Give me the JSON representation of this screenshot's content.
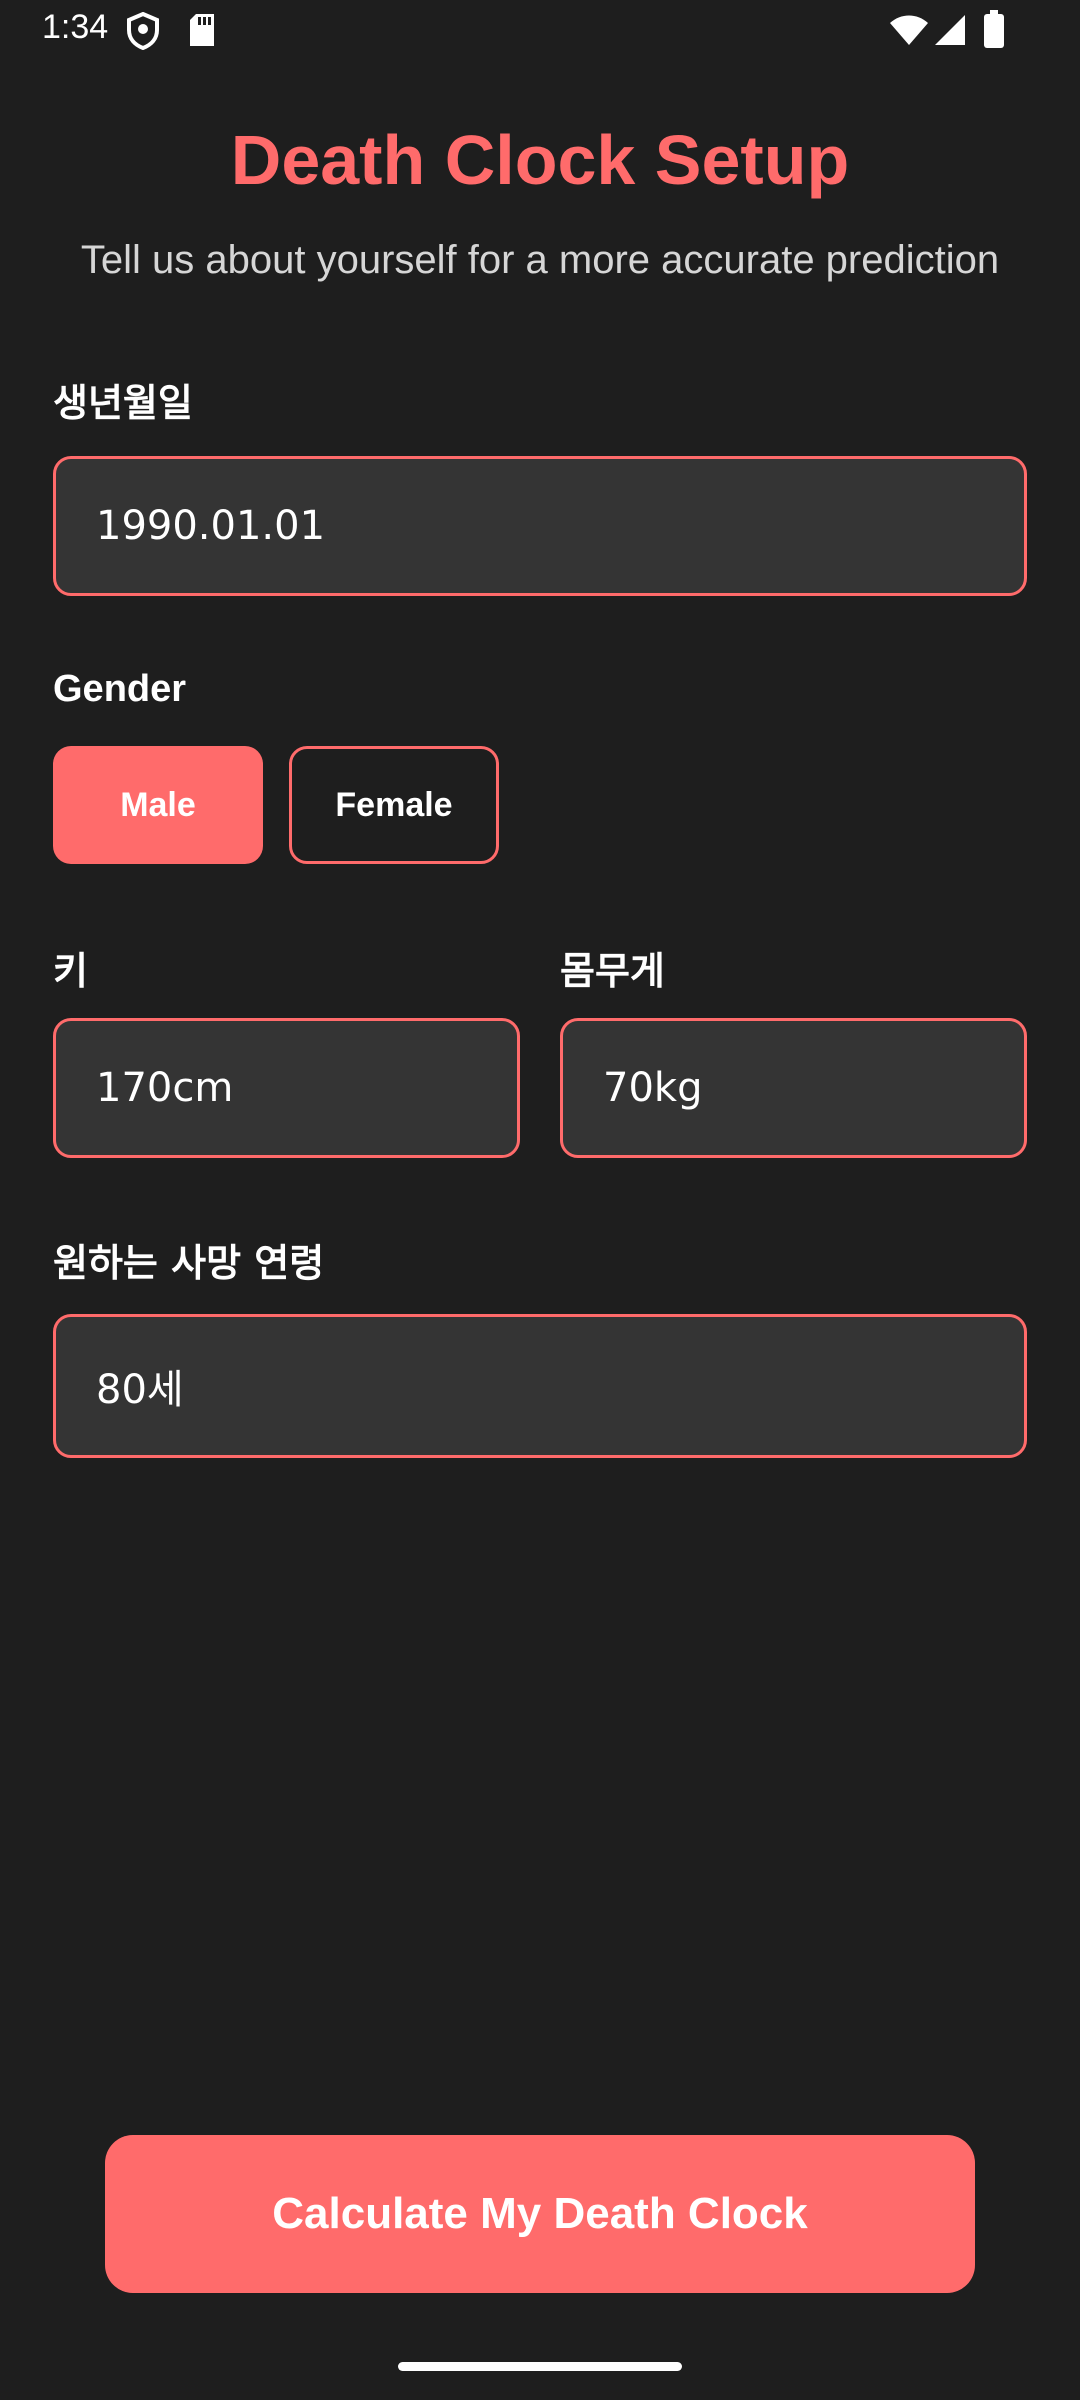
{
  "status_bar": {
    "time": "1:34",
    "icons": [
      "shield-icon",
      "sd-card-icon",
      "wifi-icon",
      "signal-icon",
      "battery-icon"
    ]
  },
  "header": {
    "title": "Death Clock Setup",
    "subtitle": "Tell us about yourself for a more accurate prediction"
  },
  "form": {
    "birthdate": {
      "label": "생년월일",
      "value": "1990.01.01"
    },
    "gender": {
      "label": "Gender",
      "options": [
        "Male",
        "Female"
      ],
      "selected": "Male"
    },
    "height": {
      "label": "키",
      "value": "170cm"
    },
    "weight": {
      "label": "몸무게",
      "value": "70kg"
    },
    "desired_age": {
      "label": "원하는 사망 연령",
      "value": "80세"
    }
  },
  "actions": {
    "calculate_label": "Calculate My Death Clock"
  },
  "colors": {
    "accent": "#ff6b6b",
    "background": "#1e1e1e",
    "field_bg": "#343434",
    "subtitle_text": "#d6d6d6"
  }
}
